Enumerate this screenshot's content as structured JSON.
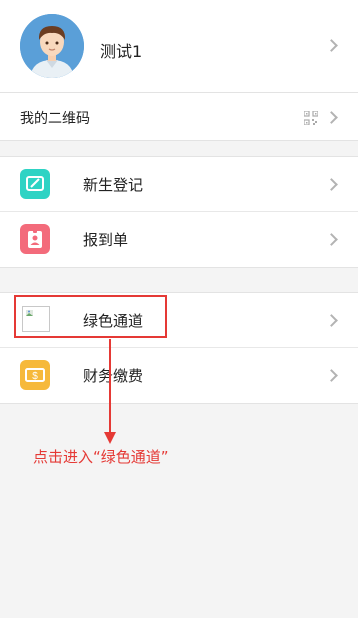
{
  "profile": {
    "name": "测试1"
  },
  "qr": {
    "label": "我的二维码"
  },
  "group1": {
    "items": [
      {
        "label": "新生登记",
        "icon": "edit-icon",
        "color": "#2ed3c4"
      },
      {
        "label": "报到单",
        "icon": "badge-icon",
        "color": "#f36b7b"
      }
    ]
  },
  "group2": {
    "items": [
      {
        "label": "绿色通道",
        "icon": "broken-image-icon"
      },
      {
        "label": "财务缴费",
        "icon": "money-icon",
        "color": "#f6b93b"
      }
    ]
  },
  "annotation": {
    "text": "点击进入“绿色通道”",
    "color": "#e53935"
  }
}
